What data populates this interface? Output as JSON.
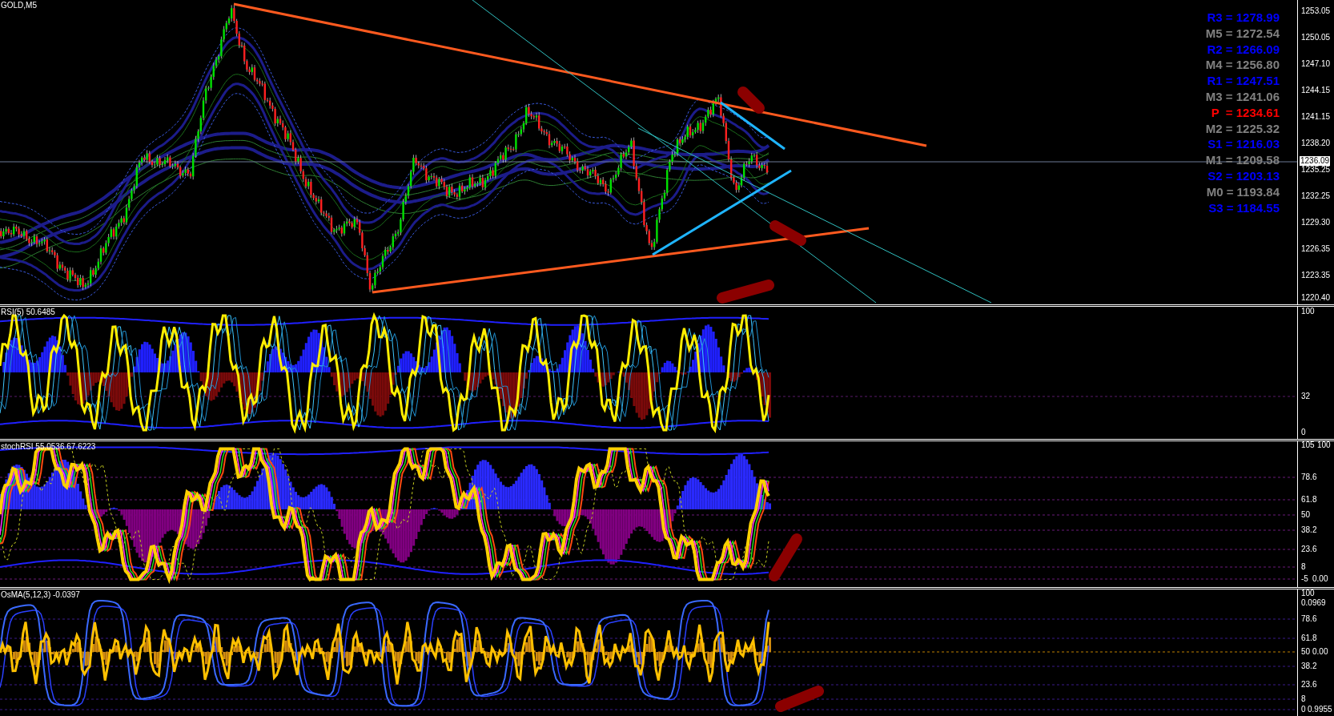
{
  "chart": {
    "symbol_title": "GOLD,M5"
  },
  "price_axis": {
    "ticks": [
      "1253.05",
      "1250.05",
      "1247.10",
      "1244.15",
      "1241.15",
      "1238.20",
      "1235.25",
      "1232.25",
      "1229.30",
      "1226.35",
      "1223.35",
      "1220.40"
    ],
    "current_price": "1236.09"
  },
  "pivot_levels": [
    {
      "label": "R3 = 1278.99",
      "color": "#0000ff"
    },
    {
      "label": "M5 = 1272.54",
      "color": "#808080"
    },
    {
      "label": "R2 = 1266.09",
      "color": "#0000ff"
    },
    {
      "label": "M4 = 1256.80",
      "color": "#808080"
    },
    {
      "label": "R1 = 1247.51",
      "color": "#0000ff"
    },
    {
      "label": "M3 = 1241.06",
      "color": "#808080"
    },
    {
      "label": "P  = 1234.61",
      "color": "#ff0000"
    },
    {
      "label": "M2 = 1225.32",
      "color": "#808080"
    },
    {
      "label": "S1 = 1216.03",
      "color": "#0000ff"
    },
    {
      "label": "M1 = 1209.58",
      "color": "#808080"
    },
    {
      "label": "S2 = 1203.13",
      "color": "#0000ff"
    },
    {
      "label": "M0 = 1193.84",
      "color": "#808080"
    },
    {
      "label": "S3 = 1184.55",
      "color": "#0000ff"
    }
  ],
  "rsi_pane": {
    "title": "RSI(5) 50.6485",
    "axis_ticks": [
      "100",
      "32",
      "0"
    ]
  },
  "stoch_rsi_pane": {
    "title": "stochRSI 55.0536 67.6223",
    "axis_ticks": [
      "105",
      "100",
      "78.6",
      "61.8",
      "50",
      "38.2",
      "23.6",
      "8",
      "-5",
      "0.00"
    ]
  },
  "osma_pane": {
    "title": "OsMA(5,12,3) -0.0397",
    "axis_ticks": [
      "100",
      "0.0969",
      "78.6",
      "61.8",
      "50",
      "0.00",
      "38.2",
      "23.6",
      "8",
      "0",
      "0.9955"
    ]
  }
}
